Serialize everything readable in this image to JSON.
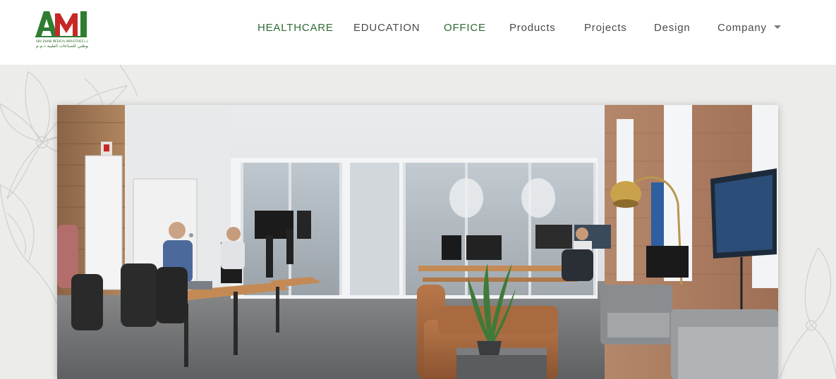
{
  "brand": {
    "logo_text": "AMI",
    "tagline_en": "ABU DHABI MEDICAL INDUSTRIES L.L.C",
    "tagline_ar": "أبوظبي للصناعات الطبية ذ.م.م",
    "green": "#2e7d32",
    "red": "#c62828"
  },
  "nav": {
    "items": [
      {
        "label": "HEALTHCARE",
        "accent": true
      },
      {
        "label": "EDUCATION",
        "accent": false
      },
      {
        "label": "OFFICE",
        "accent": true
      },
      {
        "label": "Products",
        "accent": false
      },
      {
        "label": "Projects",
        "accent": false
      },
      {
        "label": "Design",
        "accent": false
      },
      {
        "label": "Company",
        "accent": false,
        "has_dropdown": true
      }
    ],
    "accent_color": "#2e6b34",
    "text_color": "#4a4a4a"
  },
  "hero": {
    "image_subject": "open-plan office photo",
    "background": "#ececeb"
  }
}
